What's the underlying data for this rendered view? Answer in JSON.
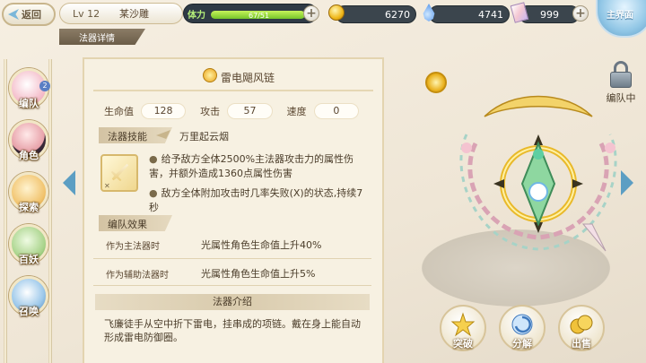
{
  "topbar": {
    "back_label": "返回",
    "level": "Lv 12",
    "player_name": "某沙雕",
    "stamina_label": "体力",
    "stamina_value": "67/51",
    "stamina_fraction": 1.0,
    "gold": "6270",
    "gems": "4741",
    "cards": "999",
    "home_label": "主界面"
  },
  "subtab_label": "法器详情",
  "nav": [
    {
      "label": "编队",
      "badge": "2",
      "color": "#f3b8c6"
    },
    {
      "label": "角色",
      "color": "#e7a0a8"
    },
    {
      "label": "探索",
      "color": "#f1c36d"
    },
    {
      "label": "百妖",
      "color": "#a8d38a"
    },
    {
      "label": "召唤",
      "color": "#9cc8ea"
    }
  ],
  "detail": {
    "name": "雷电飓风链",
    "stats": [
      {
        "label": "生命值",
        "value": "128"
      },
      {
        "label": "攻击",
        "value": "57"
      },
      {
        "label": "速度",
        "value": "0"
      }
    ],
    "skill_section": "法器技能",
    "skill_name": "万里起云烟",
    "skill_effects": [
      "给予敌方全体2500%主法器攻击力的属性伤害，并额外造成1360点属性伤害",
      "敌方全体附加攻击时几率失败(X)的状态,持续7秒"
    ],
    "team_section": "编队效果",
    "team_effects": [
      {
        "label": "作为主法器时",
        "value": "光属性角色生命值上升40%"
      },
      {
        "label": "作为辅助法器时",
        "value": "光属性角色生命值上升5%"
      }
    ],
    "intro_title": "法器介绍",
    "intro_text": "飞廉徒手从空中折下雷电，挂串成的项链。戴在身上能自动形成雷电防御圈。"
  },
  "lock_label": "编队中",
  "actions": {
    "breakthrough": "突破",
    "decompose": "分解",
    "sell": "出售"
  }
}
